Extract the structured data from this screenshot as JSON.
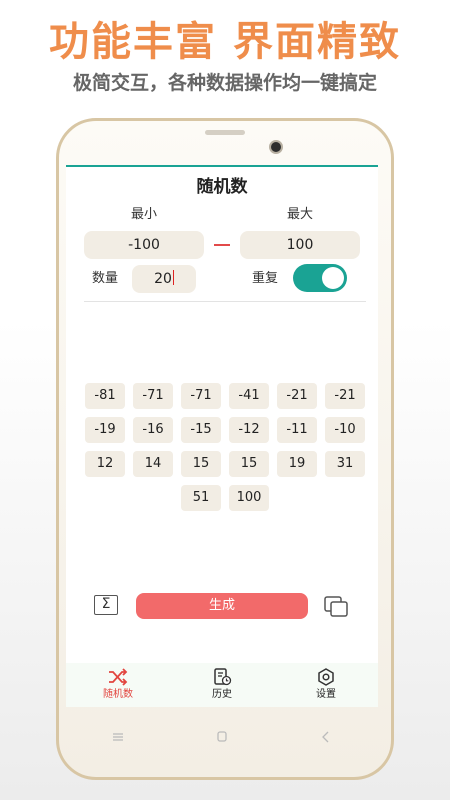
{
  "promo": {
    "title": "功能丰富 界面精致",
    "subtitle": "极简交互，各种数据操作均一键搞定"
  },
  "app": {
    "title": "随机数",
    "min_label": "最小",
    "max_label": "最大",
    "min_value": "-100",
    "max_value": "100",
    "count_label": "数量",
    "count_value": "20",
    "repeat_label": "重复",
    "repeat_enabled": true,
    "results": [
      "-81",
      "-71",
      "-71",
      "-41",
      "-21",
      "-21",
      "-19",
      "-16",
      "-15",
      "-12",
      "-11",
      "-10",
      "12",
      "14",
      "15",
      "15",
      "19",
      "31",
      "51",
      "100"
    ],
    "generate_label": "生成",
    "sum_icon": "Σ"
  },
  "nav": {
    "items": [
      {
        "label": "随机数",
        "icon": "shuffle-icon",
        "active": true
      },
      {
        "label": "历史",
        "icon": "history-icon",
        "active": false
      },
      {
        "label": "设置",
        "icon": "settings-icon",
        "active": false
      }
    ]
  },
  "colors": {
    "accent": "#1aa394",
    "generate": "#f26a6a",
    "active_nav": "#e2453f",
    "promo": "#ef8d4b"
  }
}
